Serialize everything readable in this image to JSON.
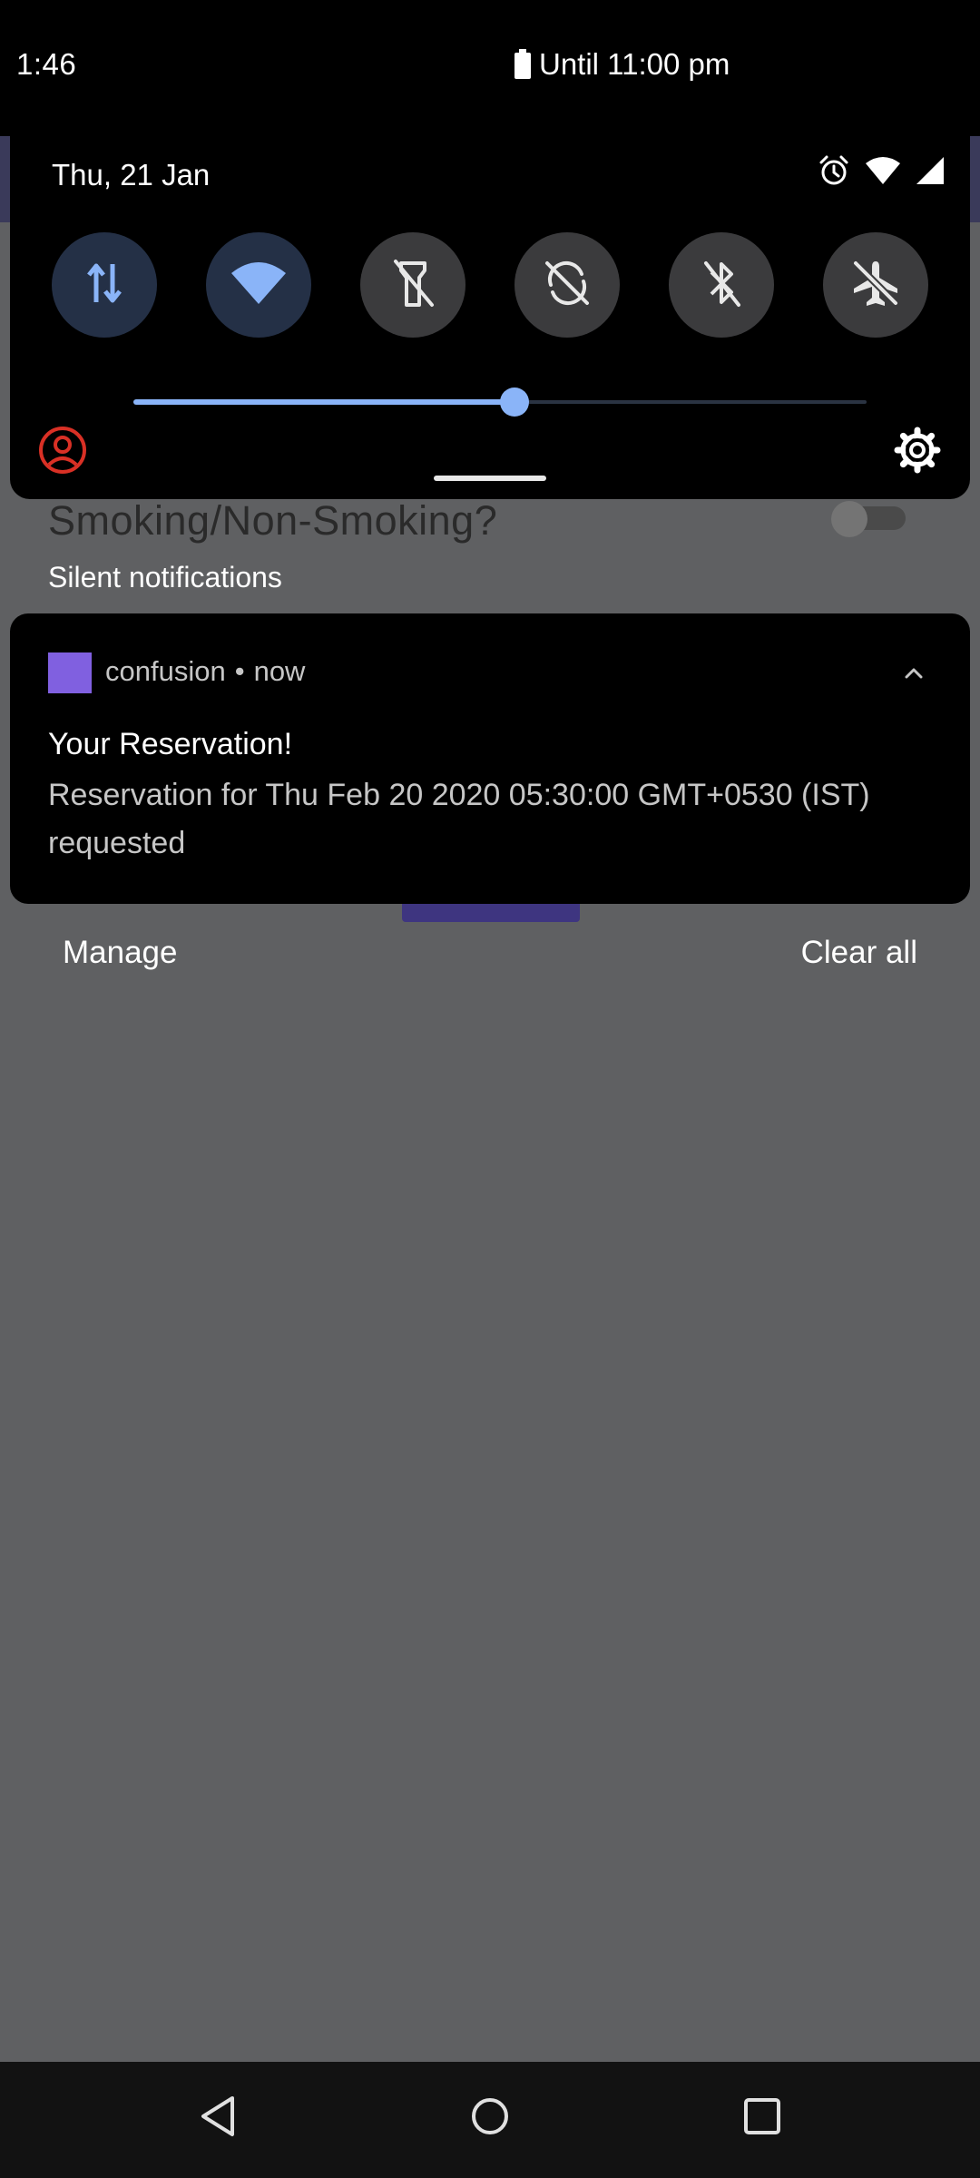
{
  "status_bar": {
    "time": "1:46",
    "battery_text": "Until 11:00 pm"
  },
  "quick_settings": {
    "date": "Thu, 21 Jan",
    "status_icons": [
      "alarm-icon",
      "wifi-signal-icon",
      "cell-signal-icon"
    ],
    "tiles": [
      {
        "name": "mobile-data",
        "icon": "data-transfer-icon",
        "state": "on"
      },
      {
        "name": "wifi",
        "icon": "wifi-icon",
        "state": "on"
      },
      {
        "name": "flashlight",
        "icon": "flashlight-off-icon",
        "state": "off"
      },
      {
        "name": "auto-rotate",
        "icon": "rotate-off-icon",
        "state": "off"
      },
      {
        "name": "bluetooth",
        "icon": "bluetooth-off-icon",
        "state": "off"
      },
      {
        "name": "airplane-mode",
        "icon": "airplane-off-icon",
        "state": "off"
      }
    ],
    "brightness_level": 0.52
  },
  "background_app": {
    "visible_label": "Smoking/Non-Smoking?"
  },
  "notifications": {
    "section_title": "Silent notifications",
    "items": [
      {
        "app_name": "confusion",
        "separator": "•",
        "time": "now",
        "title": "Your Reservation!",
        "body": "Reservation for Thu Feb 20 2020 05:30:00 GMT+0530 (IST) requested"
      }
    ],
    "manage_label": "Manage",
    "clear_all_label": "Clear all"
  },
  "colors": {
    "accent": "#8ab4f8",
    "panel": "#000000",
    "scrim": "#5f6062",
    "app_icon": "#8060e0",
    "user_icon": "#d93025"
  }
}
